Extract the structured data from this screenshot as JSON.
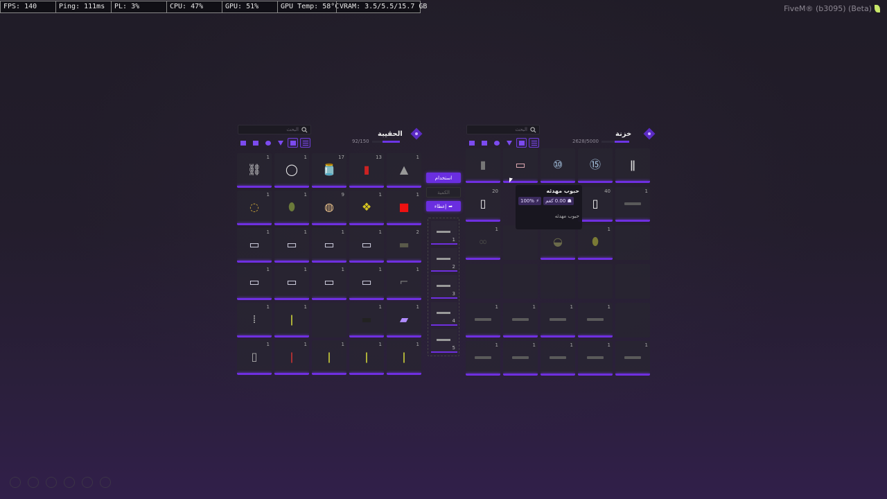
{
  "perf": {
    "fps": "FPS: 140",
    "ping": "Ping: 111ms",
    "pl": "PL: 3%",
    "cpu": "CPU: 47%",
    "gpu": "GPU: 51%",
    "gpu_temp": "GPU Temp: 58°C",
    "vram": "VRAM: 3.5/5.5/15.7 GB"
  },
  "fivem_label": "FiveM® (b3095) (Beta)",
  "player_inventory": {
    "title": "الحقيبة",
    "search_placeholder": "البحث",
    "weight": "92/150",
    "weight_fraction": 0.61,
    "filters": [
      "shirt-icon",
      "box-icon",
      "cube-icon",
      "gun-icon",
      "wrench-icon",
      "list-icon"
    ],
    "active_filters": [
      4,
      5
    ],
    "rows": [
      [
        {
          "icon": "handcuffs-icon",
          "glyph": "⛓",
          "qty": "1",
          "color": "#ddd"
        },
        {
          "icon": "ring-icon",
          "glyph": "◯",
          "qty": "1",
          "color": "#eee"
        },
        {
          "icon": "jar-icon",
          "glyph": "🫙",
          "qty": "17",
          "color": "#b33"
        },
        {
          "icon": "cup-icon",
          "glyph": "▮",
          "qty": "13",
          "color": "#c22"
        },
        {
          "icon": "bag-icon",
          "glyph": "▲",
          "qty": "1",
          "color": "#999"
        }
      ],
      [
        {
          "icon": "nut-icon",
          "glyph": "◌",
          "qty": "1",
          "color": "#c9a43a"
        },
        {
          "icon": "grenade-icon",
          "glyph": "⬮",
          "qty": "1",
          "color": "#6b7a3a"
        },
        {
          "icon": "donut-icon",
          "glyph": "◍",
          "qty": "9",
          "color": "#e8c08a"
        },
        {
          "icon": "scuba-icon",
          "glyph": "❖",
          "qty": "1",
          "color": "#d6c41f"
        },
        {
          "icon": "gascan-icon",
          "glyph": "■",
          "qty": "1",
          "color": "#e11"
        }
      ],
      [
        {
          "icon": "book-icon",
          "glyph": "▭",
          "qty": "1",
          "color": "#dde"
        },
        {
          "icon": "book-icon",
          "glyph": "▭",
          "qty": "1",
          "color": "#dde"
        },
        {
          "icon": "book-icon",
          "glyph": "▭",
          "qty": "1",
          "color": "#dde"
        },
        {
          "icon": "book-icon",
          "glyph": "▭",
          "qty": "1",
          "color": "#dde"
        },
        {
          "icon": "duffel-icon",
          "glyph": "▬",
          "qty": "2",
          "color": "#5a5a4a"
        }
      ],
      [
        {
          "icon": "book-icon",
          "glyph": "▭",
          "qty": "1",
          "color": "#dde"
        },
        {
          "icon": "book-icon",
          "glyph": "▭",
          "qty": "1",
          "color": "#dde"
        },
        {
          "icon": "book-icon",
          "glyph": "▭",
          "qty": "1",
          "color": "#dde"
        },
        {
          "icon": "book-icon",
          "glyph": "▭",
          "qty": "1",
          "color": "#dde"
        },
        {
          "icon": "pistol-icon",
          "glyph": "⌐",
          "qty": "1",
          "color": "#777"
        }
      ],
      [
        {
          "icon": "pen-icon",
          "glyph": "⁞",
          "qty": "1",
          "color": "#aaa"
        },
        {
          "icon": "bottle-icon",
          "glyph": "ǀ",
          "qty": "1",
          "color": "#cdd23a"
        },
        {
          "icon": "",
          "glyph": "",
          "qty": "",
          "color": ""
        },
        {
          "icon": "device-icon",
          "glyph": "▬",
          "qty": "1",
          "color": "#222"
        },
        {
          "icon": "phone-icon",
          "glyph": "▰",
          "qty": "1",
          "color": "#b18cff"
        }
      ],
      [
        {
          "icon": "radio-icon",
          "glyph": "▯",
          "qty": "1",
          "color": "#aaa"
        },
        {
          "icon": "flare-icon",
          "glyph": "ǀ",
          "qty": "1",
          "color": "#c33"
        },
        {
          "icon": "bottle-icon",
          "glyph": "ǀ",
          "qty": "1",
          "color": "#cdd23a"
        },
        {
          "icon": "bottle-icon",
          "glyph": "ǀ",
          "qty": "1",
          "color": "#cdd23a"
        },
        {
          "icon": "bottle-icon",
          "glyph": "ǀ",
          "qty": "1",
          "color": "#cdd23a"
        }
      ]
    ]
  },
  "middle": {
    "use_label": "استخدام",
    "amount_placeholder": "الكمية",
    "give_label": "إعطاء",
    "hotbar": [
      "1",
      "2",
      "3",
      "4",
      "5"
    ]
  },
  "stash": {
    "title": "خزنة",
    "search_placeholder": "البحث",
    "weight": "2628/5000",
    "weight_fraction": 0.53,
    "filters": [
      "shirt-icon",
      "box-icon",
      "cube-icon",
      "gun-icon",
      "swap-icon",
      "list-icon"
    ],
    "active_filters": [
      4,
      5
    ],
    "rows": [
      [
        {
          "icon": "magazine-icon",
          "glyph": "▮",
          "qty": "",
          "color": "#777"
        },
        {
          "icon": "pills-strip-icon",
          "glyph": "▭",
          "qty": "",
          "color": "#f1b7c0"
        },
        {
          "icon": "coin10-icon",
          "glyph": "⑩",
          "qty": "",
          "color": "#a9c8e6"
        },
        {
          "icon": "coin15-icon",
          "glyph": "⑮",
          "qty": "",
          "color": "#a9c8e6"
        },
        {
          "icon": "vial-icon",
          "glyph": "ǁ",
          "qty": "",
          "color": "#ddd"
        }
      ],
      [
        {
          "icon": "pill-bottle-icon",
          "glyph": "▯",
          "qty": "20",
          "color": "#eee"
        },
        {
          "icon": "",
          "glyph": "",
          "qty": "",
          "color": "",
          "hidden": true
        },
        {
          "icon": "",
          "glyph": "",
          "qty": "",
          "color": "",
          "hidden": true
        },
        {
          "icon": "pill-bottle-red-icon",
          "glyph": "▯",
          "qty": "40",
          "color": "#f5f5f5"
        },
        {
          "icon": "rifle-icon",
          "glyph": "—",
          "qty": "1",
          "color": "#555"
        }
      ],
      [
        {
          "icon": "binoculars-icon",
          "glyph": "∞",
          "qty": "1",
          "color": "#444"
        },
        {
          "icon": "",
          "glyph": "",
          "qty": "",
          "color": ""
        },
        {
          "icon": "landmine-icon",
          "glyph": "◒",
          "qty": "",
          "color": "#6a6a4a"
        },
        {
          "icon": "grenade-icon",
          "glyph": "⬮",
          "qty": "1",
          "color": "#7a7a35"
        },
        {
          "icon": "",
          "glyph": "",
          "qty": "",
          "color": ""
        }
      ],
      [
        {
          "icon": "",
          "glyph": "",
          "qty": "",
          "color": ""
        },
        {
          "icon": "",
          "glyph": "",
          "qty": "",
          "color": ""
        },
        {
          "icon": "",
          "glyph": "",
          "qty": "",
          "color": ""
        },
        {
          "icon": "",
          "glyph": "",
          "qty": "",
          "color": ""
        },
        {
          "icon": "",
          "glyph": "",
          "qty": "",
          "color": ""
        }
      ],
      [
        {
          "icon": "rifle-icon",
          "glyph": "—",
          "qty": "1",
          "color": "#555"
        },
        {
          "icon": "rifle-icon",
          "glyph": "—",
          "qty": "1",
          "color": "#555"
        },
        {
          "icon": "rifle-icon",
          "glyph": "—",
          "qty": "1",
          "color": "#555"
        },
        {
          "icon": "rifle-icon",
          "glyph": "—",
          "qty": "1",
          "color": "#555"
        },
        {
          "icon": "",
          "glyph": "",
          "qty": "",
          "color": ""
        }
      ],
      [
        {
          "icon": "rifle-icon",
          "glyph": "—",
          "qty": "1",
          "color": "#555"
        },
        {
          "icon": "rifle-icon",
          "glyph": "—",
          "qty": "1",
          "color": "#555"
        },
        {
          "icon": "rifle-icon",
          "glyph": "—",
          "qty": "1",
          "color": "#555"
        },
        {
          "icon": "rifle-icon",
          "glyph": "—",
          "qty": "1",
          "color": "#555"
        },
        {
          "icon": "rifle-icon",
          "glyph": "—",
          "qty": "1",
          "color": "#555"
        }
      ]
    ]
  },
  "tooltip": {
    "title": "حبوب مهدئه",
    "weight": "0.00 كغم",
    "durability": "100%",
    "description": "حبوب مهدئه"
  },
  "colors": {
    "accent": "#6f2fe0",
    "slot_bg": "#28262f"
  }
}
